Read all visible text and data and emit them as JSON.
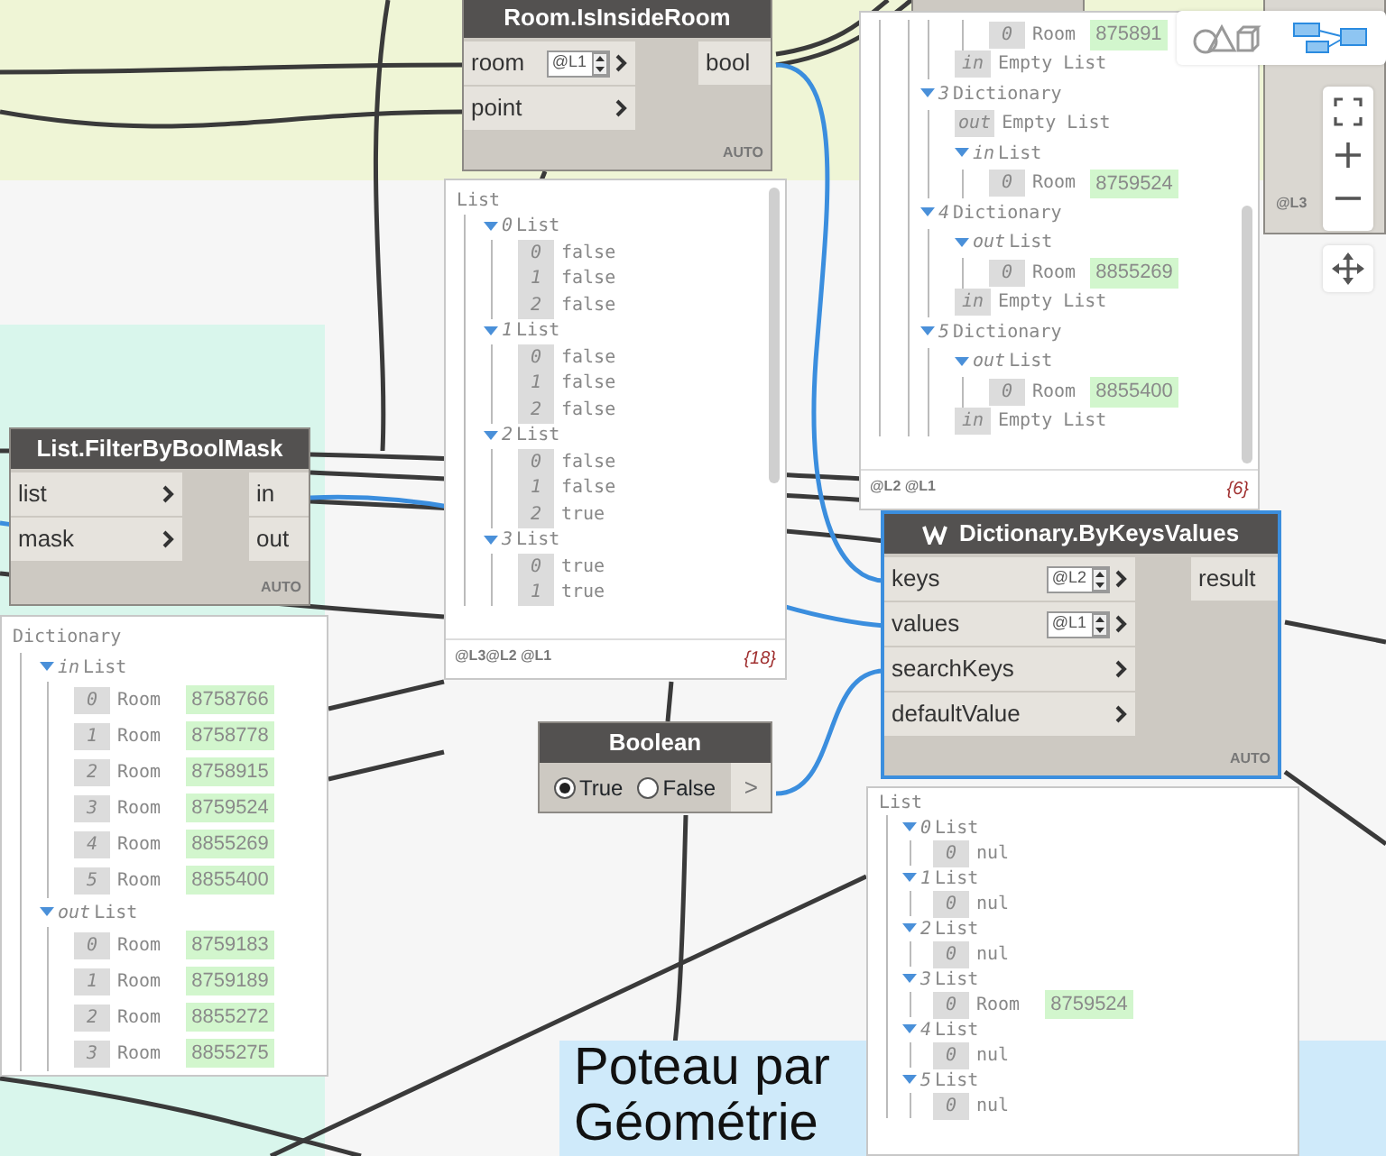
{
  "nodes": [
    {
      "kind": "function",
      "title": "Room.IsInsideRoom",
      "selected": false,
      "replication_icon": false,
      "inputs": [
        {
          "name": "room",
          "lacing": "@L1"
        },
        {
          "name": "point"
        }
      ],
      "outputs": [
        {
          "name": "bool"
        }
      ],
      "mode": "AUTO"
    },
    {
      "kind": "watch",
      "title": "List",
      "items": [
        {
          "kind": "branch",
          "key": "0",
          "text": "List",
          "expanded": true,
          "children": [
            {
              "kind": "leaf",
              "key": "0",
              "text": "false"
            },
            {
              "kind": "leaf",
              "key": "1",
              "text": "false"
            },
            {
              "kind": "leaf",
              "key": "2",
              "text": "false"
            }
          ]
        },
        {
          "kind": "branch",
          "key": "1",
          "text": "List",
          "expanded": true,
          "children": [
            {
              "kind": "leaf",
              "key": "0",
              "text": "false"
            },
            {
              "kind": "leaf",
              "key": "1",
              "text": "false"
            },
            {
              "kind": "leaf",
              "key": "2",
              "text": "false"
            }
          ]
        },
        {
          "kind": "branch",
          "key": "2",
          "text": "List",
          "expanded": true,
          "children": [
            {
              "kind": "leaf",
              "key": "0",
              "text": "false"
            },
            {
              "kind": "leaf",
              "key": "1",
              "text": "false"
            },
            {
              "kind": "leaf",
              "key": "2",
              "text": "true"
            }
          ]
        },
        {
          "kind": "branch",
          "key": "3",
          "text": "List",
          "expanded": true,
          "children": [
            {
              "kind": "leaf",
              "key": "0",
              "text": "true"
            },
            {
              "kind": "leaf",
              "key": "1",
              "text": "true"
            }
          ]
        }
      ],
      "levels": "@L3@L2 @L1",
      "count": "{18}"
    },
    {
      "kind": "watch",
      "items": [
        {
          "kind": "continuation",
          "children": [
            {
              "kind": "continuation",
              "children": [
                {
                  "kind": "leaf",
                  "key": "0",
                  "text": "Room",
                  "value": "875891"
                }
              ]
            },
            {
              "kind": "leaf",
              "key": "in",
              "text": "Empty List"
            }
          ]
        },
        {
          "kind": "branch",
          "key": "3",
          "text": "Dictionary",
          "expanded": true,
          "children": [
            {
              "kind": "leaf",
              "key": "out",
              "text": "Empty List"
            },
            {
              "kind": "branch",
              "key": "in",
              "text": "List",
              "expanded": true,
              "children": [
                {
                  "kind": "leaf",
                  "key": "0",
                  "text": "Room",
                  "value": "8759524"
                }
              ]
            }
          ]
        },
        {
          "kind": "branch",
          "key": "4",
          "text": "Dictionary",
          "expanded": true,
          "children": [
            {
              "kind": "branch",
              "key": "out",
              "text": "List",
              "expanded": true,
              "children": [
                {
                  "kind": "leaf",
                  "key": "0",
                  "text": "Room",
                  "value": "8855269"
                }
              ]
            },
            {
              "kind": "leaf",
              "key": "in",
              "text": "Empty List"
            }
          ]
        },
        {
          "kind": "branch",
          "key": "5",
          "text": "Dictionary",
          "expanded": true,
          "children": [
            {
              "kind": "branch",
              "key": "out",
              "text": "List",
              "expanded": true,
              "children": [
                {
                  "kind": "leaf",
                  "key": "0",
                  "text": "Room",
                  "value": "8855400"
                }
              ]
            },
            {
              "kind": "leaf",
              "key": "in",
              "text": "Empty List"
            }
          ]
        }
      ],
      "levels": "@L2 @L1",
      "count": "{6}"
    },
    {
      "kind": "function",
      "title": "List.FilterByBoolMask",
      "selected": false,
      "replication_icon": false,
      "inputs": [
        {
          "name": "list"
        },
        {
          "name": "mask"
        }
      ],
      "outputs": [
        {
          "name": "in"
        },
        {
          "name": "out"
        }
      ],
      "mode": "AUTO"
    },
    {
      "kind": "watch",
      "title": "Dictionary",
      "items": [
        {
          "kind": "branch",
          "key": "in",
          "text": "List",
          "expanded": true,
          "children": [
            {
              "kind": "leaf",
              "key": "0",
              "text": "Room",
              "value": "8758766"
            },
            {
              "kind": "leaf",
              "key": "1",
              "text": "Room",
              "value": "8758778"
            },
            {
              "kind": "leaf",
              "key": "2",
              "text": "Room",
              "value": "8758915"
            },
            {
              "kind": "leaf",
              "key": "3",
              "text": "Room",
              "value": "8759524"
            },
            {
              "kind": "leaf",
              "key": "4",
              "text": "Room",
              "value": "8855269"
            },
            {
              "kind": "leaf",
              "key": "5",
              "text": "Room",
              "value": "8855400"
            }
          ]
        },
        {
          "kind": "branch",
          "key": "out",
          "text": "List",
          "expanded": true,
          "children": [
            {
              "kind": "leaf",
              "key": "0",
              "text": "Room",
              "value": "8759183"
            },
            {
              "kind": "leaf",
              "key": "1",
              "text": "Room",
              "value": "8759189"
            },
            {
              "kind": "leaf",
              "key": "2",
              "text": "Room",
              "value": "8855272"
            },
            {
              "kind": "leaf",
              "key": "3",
              "text": "Room",
              "value": "8855275"
            }
          ]
        }
      ]
    },
    {
      "kind": "function",
      "title": "Dictionary.ByKeysValues",
      "selected": true,
      "replication_icon": true,
      "inputs": [
        {
          "name": "keys",
          "lacing": "@L2"
        },
        {
          "name": "values",
          "lacing": "@L1"
        },
        {
          "name": "searchKeys"
        },
        {
          "name": "defaultValue"
        }
      ],
      "outputs": [
        {
          "name": "result"
        }
      ],
      "mode": "AUTO"
    },
    {
      "kind": "watch",
      "title": "List",
      "items": [
        {
          "kind": "branch",
          "key": "0",
          "text": "List",
          "expanded": true,
          "children": [
            {
              "kind": "leaf",
              "key": "0",
              "text": "nul"
            }
          ]
        },
        {
          "kind": "branch",
          "key": "1",
          "text": "List",
          "expanded": true,
          "children": [
            {
              "kind": "leaf",
              "key": "0",
              "text": "nul"
            }
          ]
        },
        {
          "kind": "branch",
          "key": "2",
          "text": "List",
          "expanded": true,
          "children": [
            {
              "kind": "leaf",
              "key": "0",
              "text": "nul"
            }
          ]
        },
        {
          "kind": "branch",
          "key": "3",
          "text": "List",
          "expanded": true,
          "children": [
            {
              "kind": "leaf",
              "key": "0",
              "text": "Room",
              "value": "8759524"
            }
          ]
        },
        {
          "kind": "branch",
          "key": "4",
          "text": "List",
          "expanded": true,
          "children": [
            {
              "kind": "leaf",
              "key": "0",
              "text": "nul"
            }
          ]
        },
        {
          "kind": "branch",
          "key": "5",
          "text": "List",
          "expanded": true,
          "children": [
            {
              "kind": "leaf",
              "key": "0",
              "text": "nul"
            }
          ]
        }
      ]
    },
    {
      "kind": "boolean",
      "title": "Boolean",
      "options": [
        {
          "label": "True",
          "selected": true
        },
        {
          "label": "False",
          "selected": false
        }
      ],
      "output": ">"
    },
    {
      "kind": "note",
      "lines": [
        "Poteau par",
        "Géométrie"
      ]
    },
    {
      "kind": "partial",
      "levels": "@L3"
    }
  ]
}
